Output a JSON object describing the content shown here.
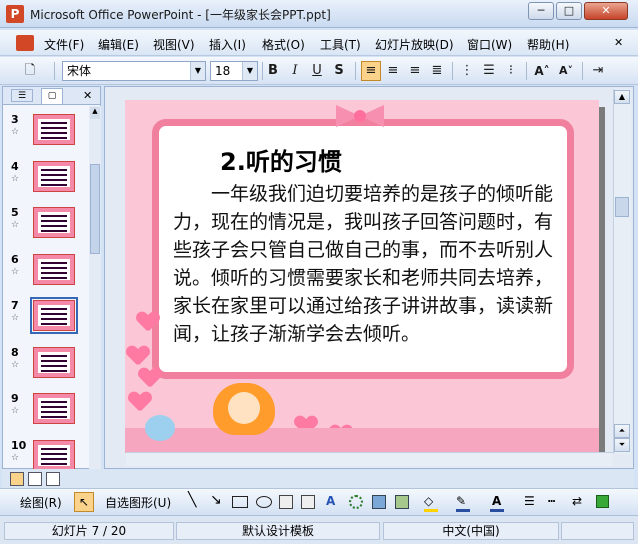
{
  "window": {
    "title": "Microsoft Office PowerPoint - [一年级家长会PPT.ppt]",
    "app_icon": "P",
    "minimize_label": "─",
    "maximize_label": "□",
    "close_label": "✕"
  },
  "menu": {
    "items": [
      "文件(F)",
      "编辑(E)",
      "视图(V)",
      "插入(I)",
      "格式(O)",
      "工具(T)",
      "幻灯片放映(D)",
      "窗口(W)",
      "帮助(H)"
    ],
    "close_doc": "✕"
  },
  "toolbar": {
    "font_name": "宋体",
    "font_size": "18",
    "bold": "B",
    "italic": "I",
    "underline": "U",
    "shadow": "S",
    "grow_font": "A˄",
    "shrink_font": "A˅"
  },
  "left_panel": {
    "close": "✕",
    "slides": [
      {
        "num": "3"
      },
      {
        "num": "4"
      },
      {
        "num": "5"
      },
      {
        "num": "6"
      },
      {
        "num": "7",
        "selected": true
      },
      {
        "num": "8"
      },
      {
        "num": "9"
      },
      {
        "num": "10"
      }
    ]
  },
  "slide": {
    "title": "2.听的习惯",
    "body": "一年级我们迫切要培养的是孩子的倾听能力，现在的情况是，我叫孩子回答问题时，有些孩子会只管自己做自己的事，而不去听别人说。倾听的习惯需要家长和老师共同去培养，家长在家里可以通过给孩子讲讲故事，读读新闻，让孩子渐渐学会去倾听。"
  },
  "drawing_toolbar": {
    "draw_label": "绘图(R)",
    "autoshapes_label": "自选图形(U)"
  },
  "status": {
    "slide_info": "幻灯片 7 / 20",
    "design": "默认设计模板",
    "language": "中文(中国)"
  },
  "colors": {
    "slide_bg": "#fbc7d6",
    "frame": "#f0809e",
    "title_bar": "#c9daf1",
    "selection": "#3568b5"
  }
}
